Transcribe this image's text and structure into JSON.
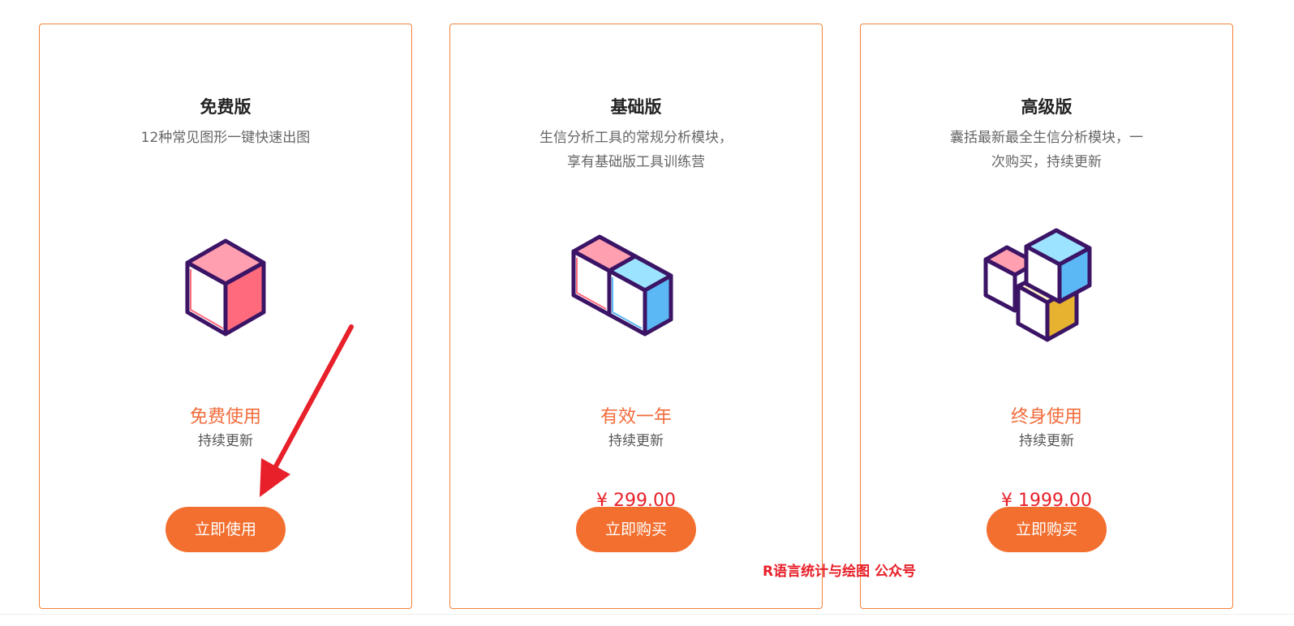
{
  "plans": [
    {
      "title": "免费版",
      "desc": "12种常见图形一键快速出图",
      "icon": "single-cube-icon",
      "validity": "免费使用",
      "update": "持续更新",
      "price": "",
      "button": "立即使用"
    },
    {
      "title": "基础版",
      "desc": "生信分析工具的常规分析模块， 享有基础版工具训练营",
      "icon": "double-cube-icon",
      "validity": "有效一年",
      "update": "持续更新",
      "price": "¥ 299.00",
      "button": "立即购买"
    },
    {
      "title": "高级版",
      "desc": "囊括最新最全生信分析模块，一次购买，持续更新",
      "icon": "triple-cube-icon",
      "validity": "终身使用",
      "update": "持续更新",
      "price": "¥ 1999.00",
      "button": "立即购买"
    }
  ],
  "watermark": "R语言统计与绘图 公众号",
  "annotation": {
    "icon": "red-arrow-icon",
    "color": "#e8202a"
  },
  "colors": {
    "accent": "#f36f2f",
    "border": "#f4823a",
    "price": "#e8202a",
    "cube_outline": "#3b1466",
    "cube_pink_light": "#ff9fb0",
    "cube_pink_dark": "#ff6b7d",
    "cube_blue_light": "#9be3ff",
    "cube_blue_dark": "#5bb8f5",
    "cube_yellow_light": "#fff3c8",
    "cube_yellow_dark": "#e6b22f"
  }
}
